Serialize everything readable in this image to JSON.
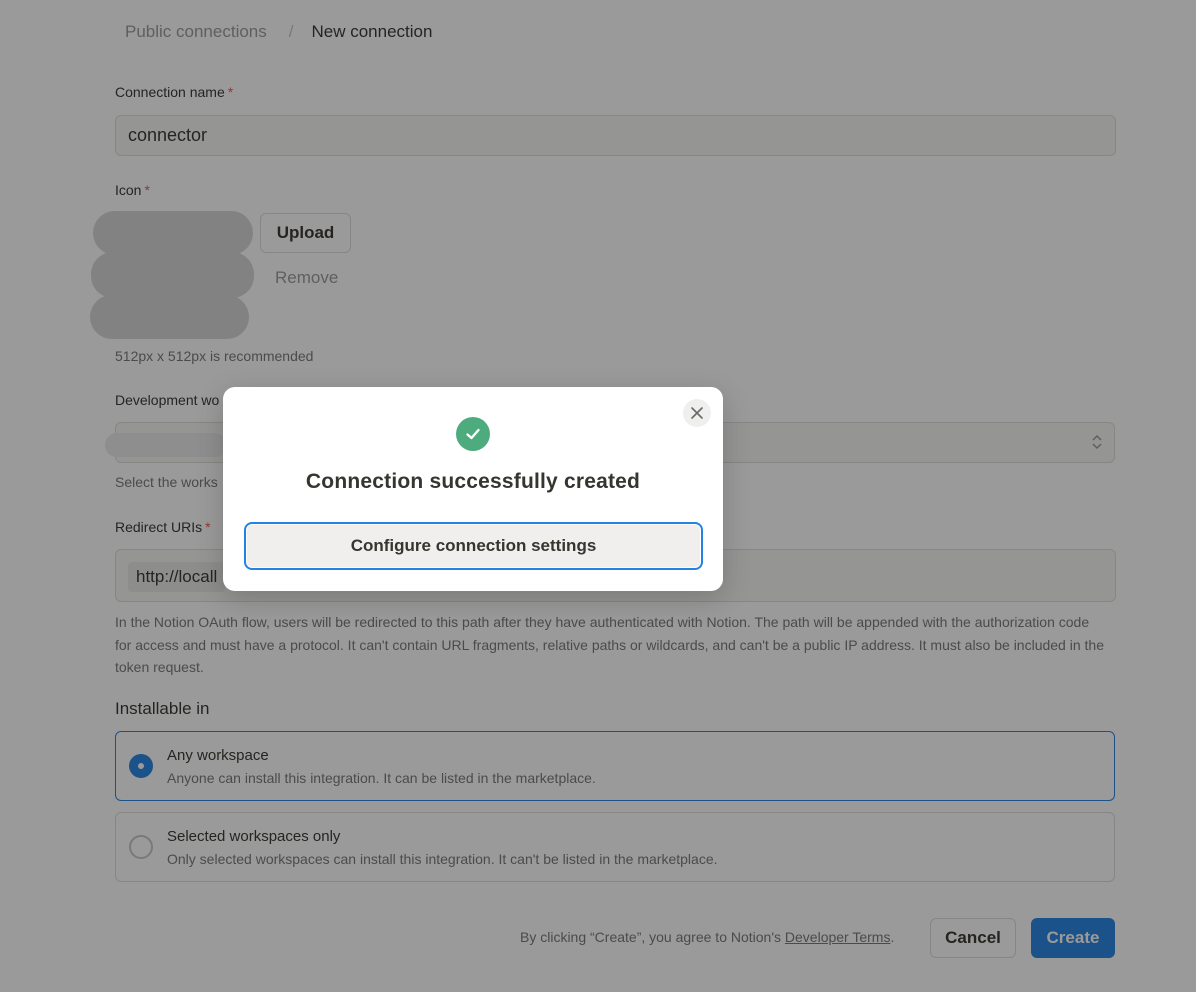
{
  "breadcrumb": {
    "parent": "Public connections",
    "separator": "/",
    "current": "New connection"
  },
  "form": {
    "name_label": "Connection name",
    "required_mark": "*",
    "name_value": "connector",
    "icon_label": "Icon",
    "upload_label": "Upload",
    "remove_label": "Remove",
    "icon_hint": "512px x 512px is recommended",
    "dev_workspace_label": "Development wo",
    "dev_workspace_hint": "Select the works",
    "redirect_label": "Redirect URIs",
    "redirect_value": "http://locall",
    "redirect_help": "In the Notion OAuth flow, users will be redirected to this path after they have authenticated with Notion. The path will be appended with the authorization code for access and must have a protocol. It can't contain URL fragments, relative paths or wildcards, and can't be a public IP address. It must also be included in the token request.",
    "installable_title": "Installable in",
    "options": [
      {
        "title": "Any workspace",
        "desc": "Anyone can install this integration. It can be listed in the marketplace.",
        "selected": true
      },
      {
        "title": "Selected workspaces only",
        "desc": "Only selected workspaces can install this integration. It can't be listed in the marketplace.",
        "selected": false
      }
    ]
  },
  "footer": {
    "note_prefix": "By clicking “Create”, you agree to Notion's ",
    "terms_link": "Developer Terms",
    "note_suffix": ".",
    "cancel_label": "Cancel",
    "create_label": "Create"
  },
  "modal": {
    "title": "Connection successfully created",
    "button_label": "Configure connection settings",
    "check_icon": "check-circle-icon",
    "close_icon": "close-icon"
  },
  "colors": {
    "accent": "#2383e2",
    "success": "#4dab7e",
    "required": "#eb5757"
  }
}
